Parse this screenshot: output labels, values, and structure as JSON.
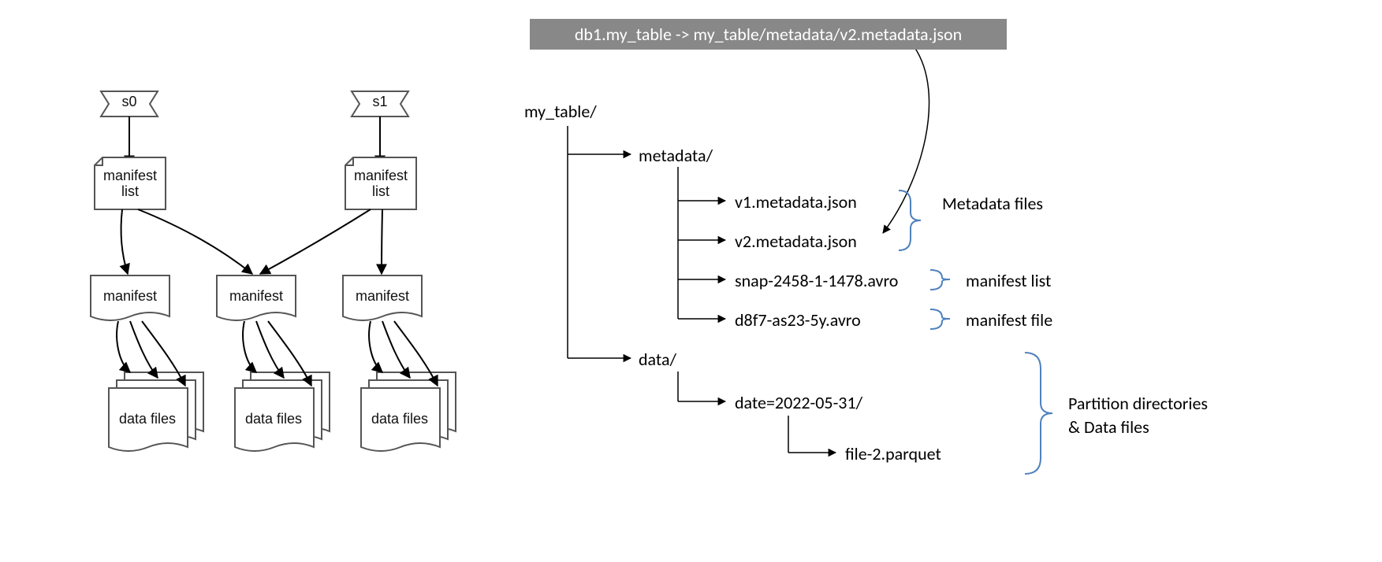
{
  "left": {
    "snapshots": [
      "s0",
      "s1"
    ],
    "manifest_list_label": "manifest\nlist",
    "manifest_label": "manifest",
    "data_files_label": "data files"
  },
  "right": {
    "banner": "db1.my_table -> my_table/metadata/v2.metadata.json",
    "root": "my_table/",
    "metadata_dir": "metadata/",
    "metadata_files": {
      "v1": "v1.metadata.json",
      "v2": "v2.metadata.json",
      "snap": "snap-2458-1-1478.avro",
      "manifest": "d8f7-as23-5y.avro"
    },
    "data_dir": "data/",
    "partition_dir": "date=2022-05-31/",
    "data_file": "file-2.parquet",
    "annotations": {
      "metadata_files": "Metadata files",
      "manifest_list": "manifest list",
      "manifest_file": "manifest file",
      "partition": "Partition directories\n& Data files"
    }
  }
}
